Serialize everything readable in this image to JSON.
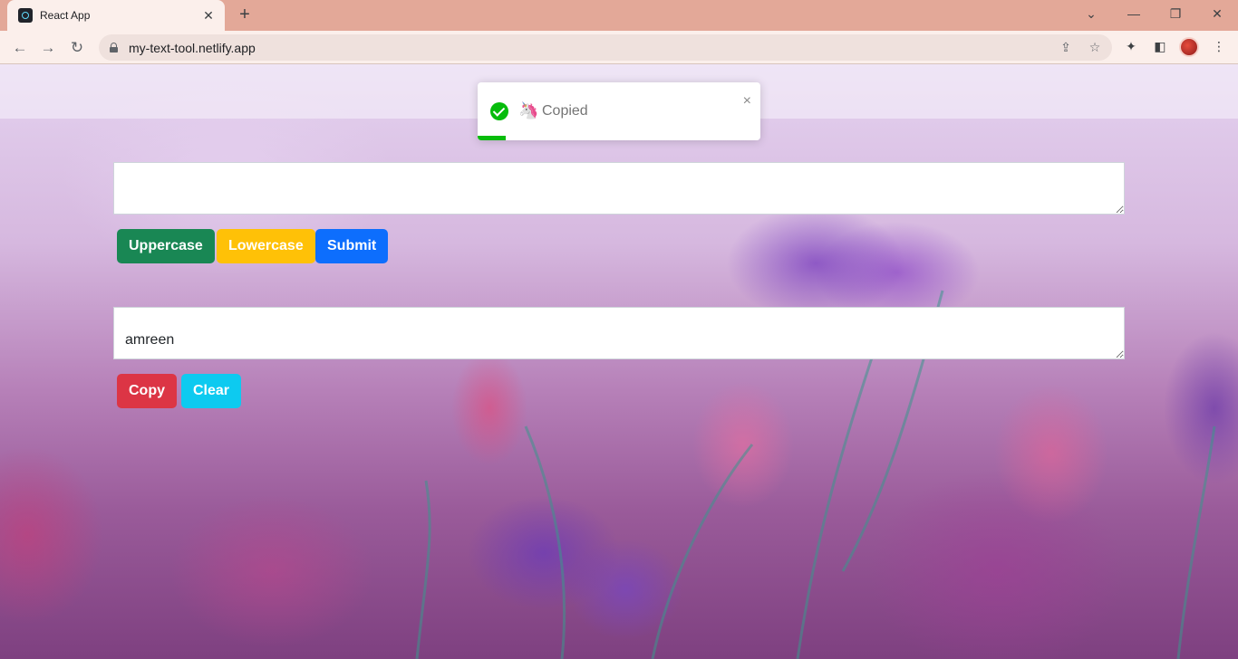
{
  "browser": {
    "tab_title": "React App",
    "url": "my-text-tool.netlify.app",
    "new_tab": "+",
    "close_tab": "✕"
  },
  "form": {
    "input_value": "",
    "output_value": "amreen",
    "buttons": {
      "uppercase": "Uppercase",
      "lowercase": "Lowercase",
      "submit": "Submit",
      "copy": "Copy",
      "clear": "Clear"
    }
  },
  "toast": {
    "emoji": "🦄",
    "message": "Copied",
    "close": "×",
    "type": "success",
    "progress": 0.1
  },
  "colors": {
    "success": "#198754",
    "warning": "#ffc107",
    "primary": "#0d6efd",
    "danger": "#dc3545",
    "info": "#0dcaf0",
    "toast_green": "#07bc0c"
  }
}
